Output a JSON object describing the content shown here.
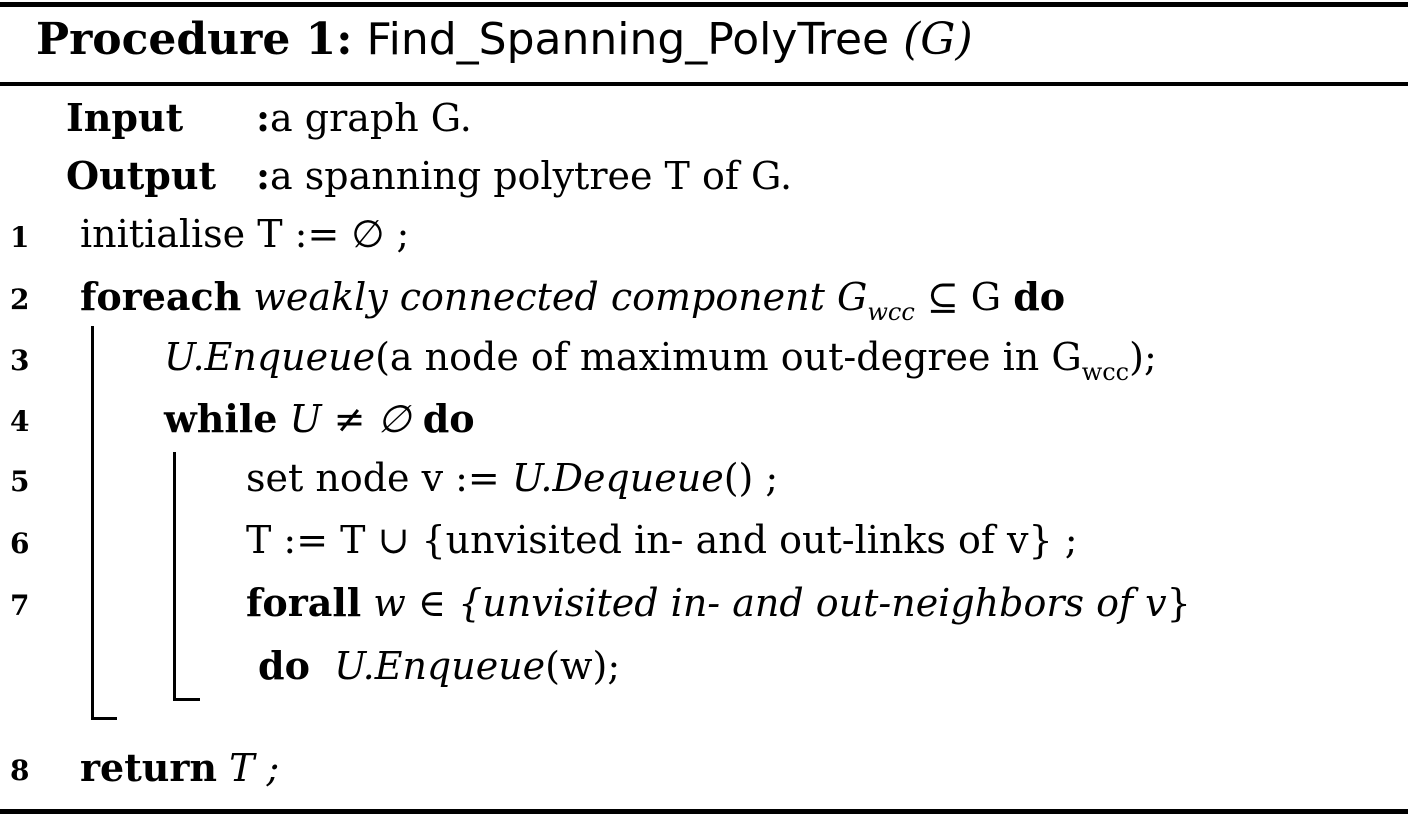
{
  "procedure": {
    "label": "Procedure 1:",
    "name": "Find_Spanning_PolyTree",
    "arg": "(G)"
  },
  "io": {
    "input_label": "Input",
    "input_sep": ":",
    "input_text": "a graph G.",
    "output_label": "Output",
    "output_sep": ":",
    "output_text": "a spanning polytree T of G."
  },
  "lines": [
    {
      "num": "1",
      "text": "initialise T := ∅ ;"
    },
    {
      "num": "2",
      "kw": "foreach",
      "cond": "weakly connected component G",
      "sub": "wcc",
      "cond_tail": " ⊆ G ",
      "kw2": "do"
    },
    {
      "num": "3",
      "call": "U.Enqueue",
      "text": "(a node of maximum out-degree in G",
      "sub": "wcc",
      "tail": ");"
    },
    {
      "num": "4",
      "kw": "while",
      "cond": " U ≠ ∅ ",
      "kw2": "do"
    },
    {
      "num": "5",
      "text": "set node v := ",
      "call": "U.Dequeue",
      "tail": "() ;"
    },
    {
      "num": "6",
      "text": "T := T ∪ {unvisited in- and out-links of v} ;"
    },
    {
      "num": "7",
      "kw": "forall",
      "cond": " w ∈ {",
      "cond_it": "unvisited in- and out-neighbors of v",
      "cond_tail": "}"
    },
    {
      "num": "",
      "kw": "do",
      "call": "U.Enqueue",
      "tail": "(w);"
    },
    {
      "num": "8",
      "kw": "return",
      "text": " T ;"
    }
  ]
}
